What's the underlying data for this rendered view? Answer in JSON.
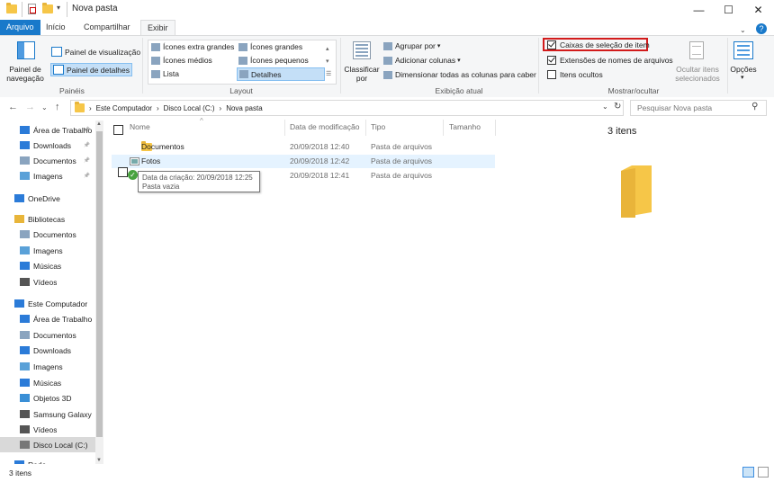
{
  "window": {
    "title": "Nova pasta"
  },
  "tabs": [
    {
      "label": "Arquivo"
    },
    {
      "label": "Início"
    },
    {
      "label": "Compartilhar"
    },
    {
      "label": "Exibir"
    }
  ],
  "ribbon": {
    "painel_navegacao": "Painel de navegação",
    "painel_visualizacao": "Painel de visualização",
    "painel_detalhes": "Painel de detalhes",
    "group_paineis": "Painéis",
    "layout": {
      "items": [
        "Ícones extra grandes",
        "Ícones grandes",
        "Ícones médios",
        "Ícones pequenos",
        "Lista",
        "Detalhes"
      ],
      "group": "Layout"
    },
    "classificar": "Classificar por",
    "agrupar": "Agrupar por",
    "adicionar_colunas": "Adicionar colunas",
    "dimensionar": "Dimensionar todas as colunas para caber",
    "group_exibicao": "Exibição atual",
    "caixas_selecao": "Caixas de seleção de item",
    "extensoes": "Extensões de nomes de arquivos",
    "itens_ocultos": "Itens ocultos",
    "ocultar_itens": "Ocultar itens selecionados",
    "group_mostrar": "Mostrar/ocultar",
    "opcoes": "Opções"
  },
  "address": {
    "crumbs": [
      "Este Computador",
      "Disco Local (C:)",
      "Nova pasta"
    ],
    "search_placeholder": "Pesquisar Nova pasta"
  },
  "nav": {
    "items": [
      "Área de Trabalho",
      "Downloads",
      "Documentos",
      "Imagens",
      "OneDrive",
      "Bibliotecas",
      "Documentos",
      "Imagens",
      "Músicas",
      "Vídeos",
      "Este Computador",
      "Área de Trabalho",
      "Documentos",
      "Downloads",
      "Imagens",
      "Músicas",
      "Objetos 3D",
      "Samsung Galaxy",
      "Vídeos",
      "Disco Local (C:)",
      "Rede"
    ]
  },
  "columns": [
    "Nome",
    "Data de modificação",
    "Tipo",
    "Tamanho"
  ],
  "files": [
    {
      "name": "Documentos",
      "date": "20/09/2018 12:40",
      "type": "Pasta de arquivos"
    },
    {
      "name": "Fotos",
      "date": "20/09/2018 12:42",
      "type": "Pasta de arquivos"
    },
    {
      "name": "",
      "date": "20/09/2018 12:41",
      "type": "Pasta de arquivos"
    }
  ],
  "tooltip": {
    "line1": "Data da criação: 20/09/2018 12:25",
    "line2": "Pasta vazia"
  },
  "preview": {
    "count": "3 itens"
  },
  "status": {
    "count": "3 itens"
  },
  "colors": {
    "accent": "#1979ca",
    "highlight": "#d21b1b",
    "folder": "#f6c648",
    "hover": "#e5f3ff"
  }
}
